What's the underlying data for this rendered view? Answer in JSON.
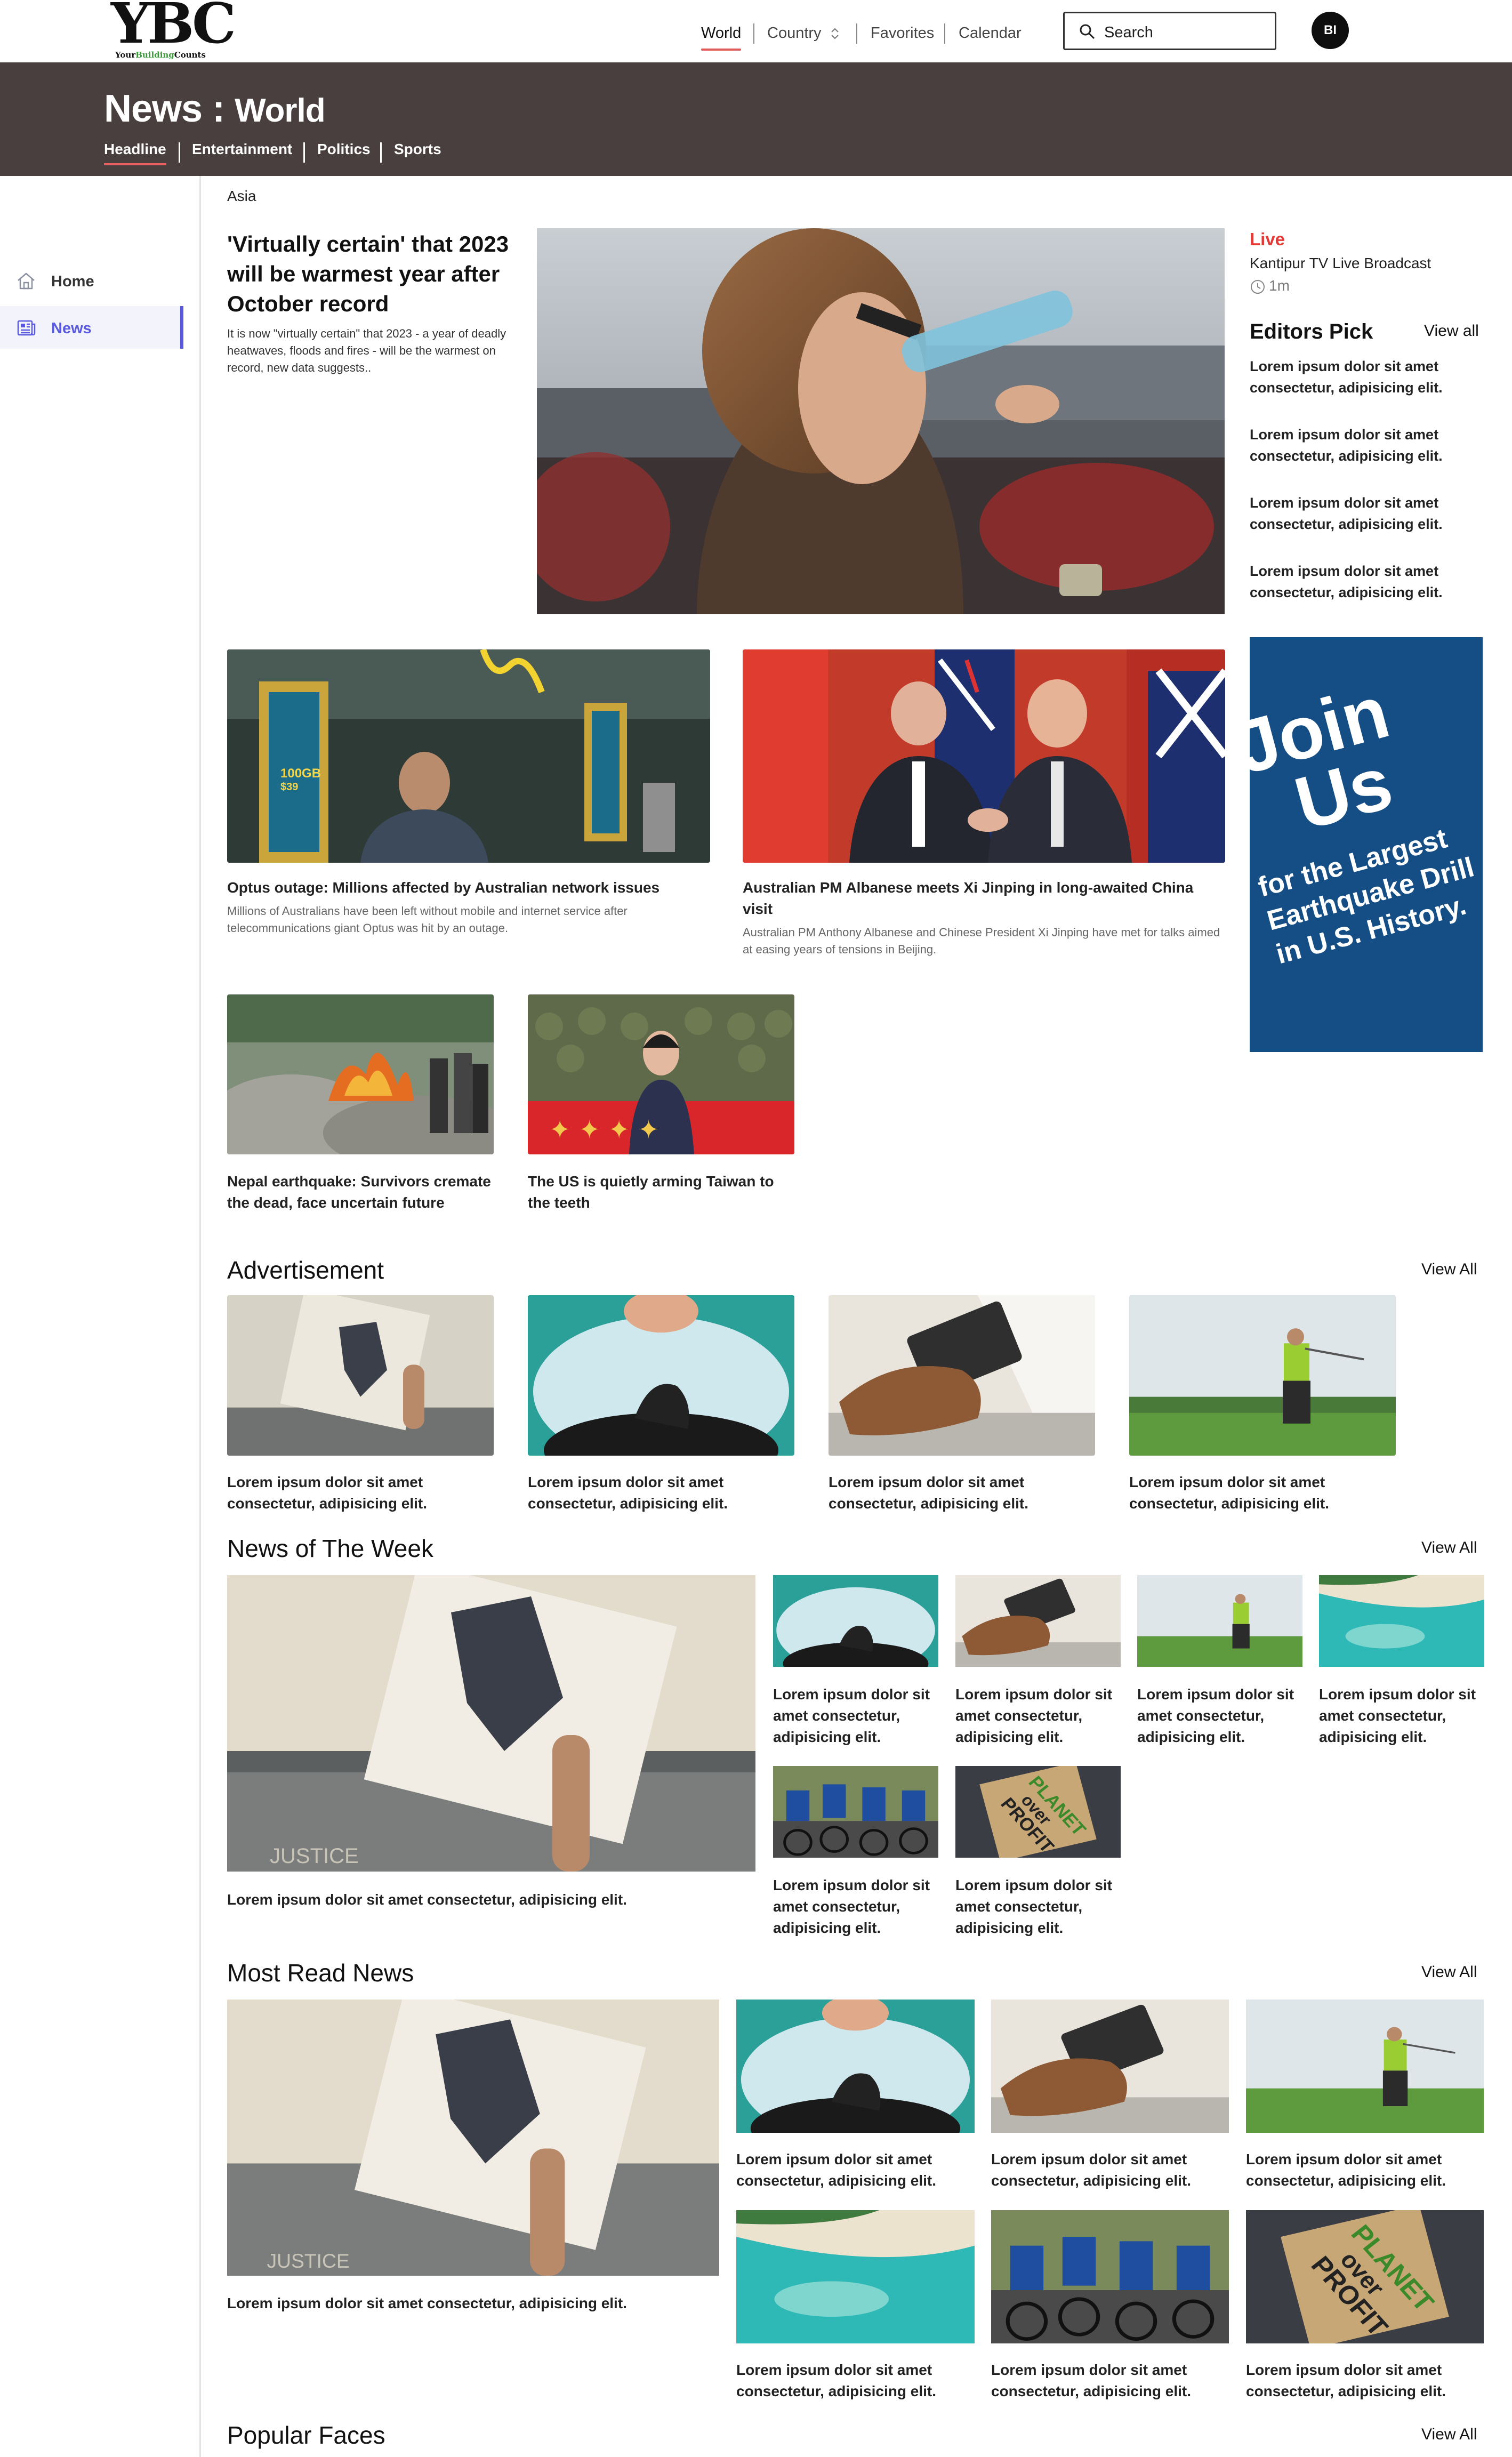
{
  "app": {
    "logo_big": "YBC",
    "logo_small_a": "Your",
    "logo_small_b": "Building",
    "logo_small_c": "Counts"
  },
  "topnav": {
    "items": [
      "World",
      "Country",
      "Favorites",
      "Calendar"
    ],
    "search_placeholder": "Search",
    "avatar": "BI"
  },
  "banner": {
    "title": "News",
    "sep": " : ",
    "subtitle": "World",
    "tabs": [
      "Headline",
      "Entertainment",
      "Politics",
      "Sports"
    ]
  },
  "sidebar": {
    "items": [
      {
        "label": "Home",
        "icon": "home-icon"
      },
      {
        "label": "News",
        "icon": "newspaper-icon"
      }
    ]
  },
  "main": {
    "region": "Asia",
    "lead": {
      "title": "'Virtually certain' that 2023 will be warmest year after October record",
      "summary": "It is now \"virtually certain\" that 2023 - a year of deadly heatwaves, floods and fires - will be the warmest on record, new data suggests.."
    },
    "stories": [
      {
        "title": "Optus outage: Millions affected by Australian network issues",
        "summary": "Millions of Australians have been left without mobile and internet service after telecommunications giant Optus was hit by an outage."
      },
      {
        "title": "Australian PM Albanese meets Xi Jinping in long-awaited China visit",
        "summary": "Australian PM Anthony Albanese and Chinese President Xi Jinping have met for talks aimed at easing years of tensions in Beijing."
      },
      {
        "title": "Nepal earthquake: Survivors cremate the dead, face uncertain future"
      },
      {
        "title": "The US is quietly arming Taiwan to the teeth"
      }
    ],
    "store_sign": "100GB",
    "store_sign_b": "$39"
  },
  "right": {
    "live_label": "Live",
    "live_channel": "Kantipur TV Live Broadcast",
    "live_time": "1m",
    "editors_title": "Editors Pick",
    "editors_view": "View all",
    "editors_items": [
      "Lorem ipsum dolor sit amet consectetur, adipisicing elit.",
      "Lorem ipsum dolor sit amet consectetur, adipisicing elit.",
      "Lorem ipsum dolor sit amet consectetur, adipisicing elit.",
      "Lorem ipsum dolor sit amet consectetur, adipisicing elit."
    ],
    "ad_lines": [
      "Join",
      "Us",
      "for the Largest",
      "Earthquake Drill",
      "in U.S. History."
    ]
  },
  "advertisement": {
    "title": "Advertisement",
    "view": "View All",
    "items": [
      "Lorem ipsum dolor sit amet consectetur, adipisicing elit.",
      "Lorem ipsum dolor sit amet consectetur, adipisicing elit.",
      "Lorem ipsum dolor sit amet consectetur, adipisicing elit.",
      "Lorem ipsum dolor sit amet consectetur, adipisicing elit."
    ]
  },
  "week": {
    "title": "News of The Week",
    "view": "View All",
    "main_caption": "Lorem ipsum dolor sit amet consectetur, adipisicing elit.",
    "items": [
      "Lorem ipsum dolor sit amet consectetur, adipisicing elit.",
      "Lorem ipsum dolor sit amet consectetur, adipisicing elit.",
      "Lorem ipsum dolor sit amet consectetur, adipisicing elit.",
      "Lorem ipsum dolor sit amet consectetur, adipisicing elit.",
      "Lorem ipsum dolor sit amet consectetur, adipisicing elit.",
      "Lorem ipsum dolor sit amet consectetur, adipisicing elit."
    ]
  },
  "mostread": {
    "title": "Most Read News",
    "view": "View All",
    "main_caption": "Lorem ipsum dolor sit amet consectetur, adipisicing elit.",
    "items": [
      "Lorem ipsum dolor sit amet consectetur, adipisicing elit.",
      "Lorem ipsum dolor sit amet consectetur, adipisicing elit.",
      "Lorem ipsum dolor sit amet consectetur, adipisicing elit.",
      "Lorem ipsum dolor sit amet consectetur, adipisicing elit.",
      "Lorem ipsum dolor sit amet consectetur, adipisicing elit.",
      "Lorem ipsum dolor sit amet consectetur, adipisicing elit."
    ]
  },
  "popular": {
    "title": "Popular Faces",
    "view": "View All"
  },
  "sign_text": [
    "PLANET",
    "over",
    "PROFIT"
  ],
  "justice_text": "JUSTICE",
  "colors": {
    "banner": "#4a3f3f",
    "accent": "#5a5ae0",
    "active_underline": "#e05a5a",
    "live": "#e53935",
    "ad_bg": "#154e85"
  }
}
